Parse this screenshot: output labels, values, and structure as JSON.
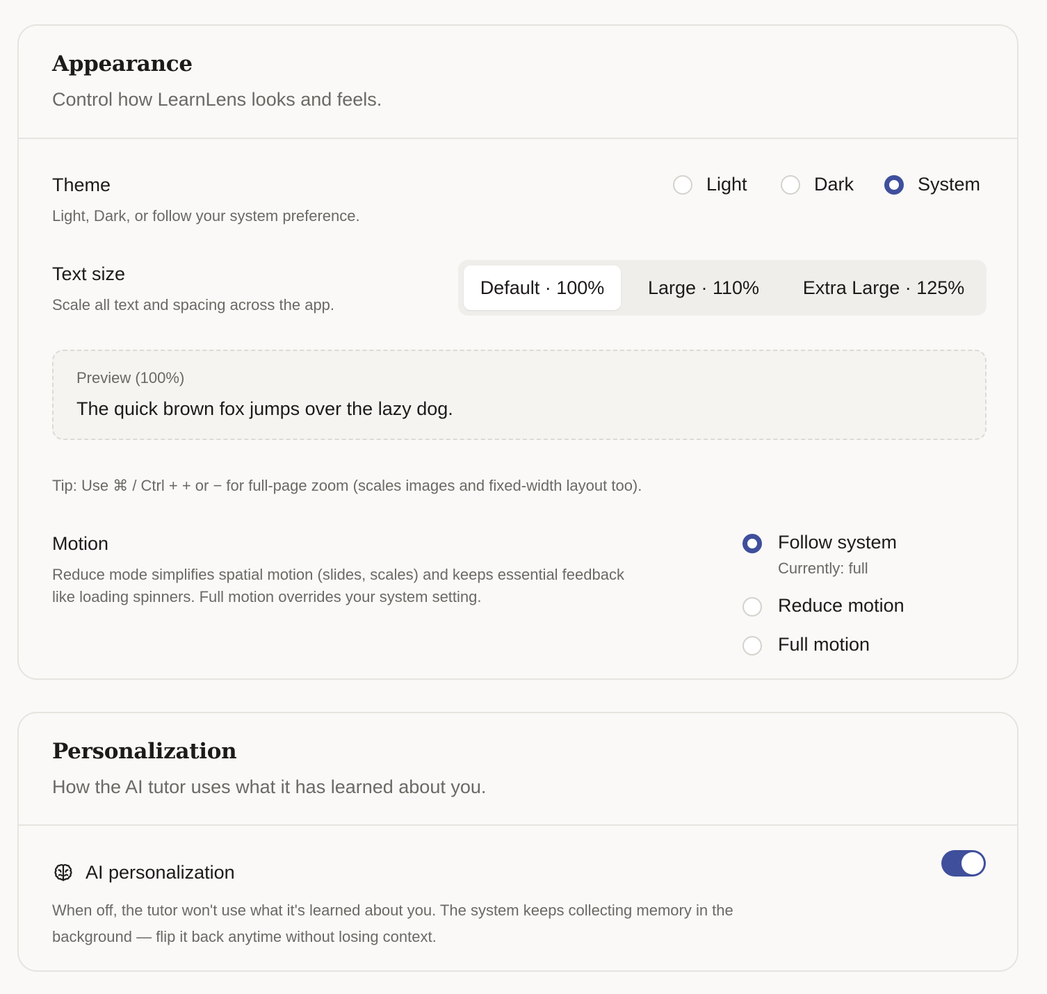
{
  "appearance": {
    "title": "Appearance",
    "subtitle": "Control how LearnLens looks and feels.",
    "theme": {
      "label": "Theme",
      "description": "Light, Dark, or follow your system preference.",
      "options": [
        "Light",
        "Dark",
        "System"
      ],
      "selected": "System"
    },
    "text_size": {
      "label": "Text size",
      "description": "Scale all text and spacing across the app.",
      "options": [
        "Default · 100%",
        "Large · 110%",
        "Extra Large · 125%"
      ],
      "selected": "Default · 100%"
    },
    "preview": {
      "label": "Preview (100%)",
      "text": "The quick brown fox jumps over the lazy dog."
    },
    "tip": "Tip: Use ⌘ / Ctrl + + or − for full-page zoom (scales images and fixed-width layout too).",
    "motion": {
      "label": "Motion",
      "description_line1": "Reduce mode simplifies spatial motion (slides, scales) and keeps essential feedback",
      "description_line2": "like loading spinners. Full motion overrides your system setting.",
      "options": [
        "Follow system",
        "Reduce motion",
        "Full motion"
      ],
      "follow_note": "Currently: full",
      "selected": "Follow system"
    }
  },
  "personalization": {
    "title": "Personalization",
    "subtitle": "How the AI tutor uses what it has learned about you.",
    "ai": {
      "label": "AI personalization",
      "icon": "brain-icon",
      "description_line1": "When off, the tutor won't use what it's learned about you. The system keeps collecting memory in the",
      "description_line2": "background — flip it back anytime without losing context.",
      "enabled": true
    }
  },
  "colors": {
    "accent": "#3f4f9c",
    "card_border": "#e6e4df",
    "background": "#faf9f7",
    "muted_text": "#6b6964"
  }
}
